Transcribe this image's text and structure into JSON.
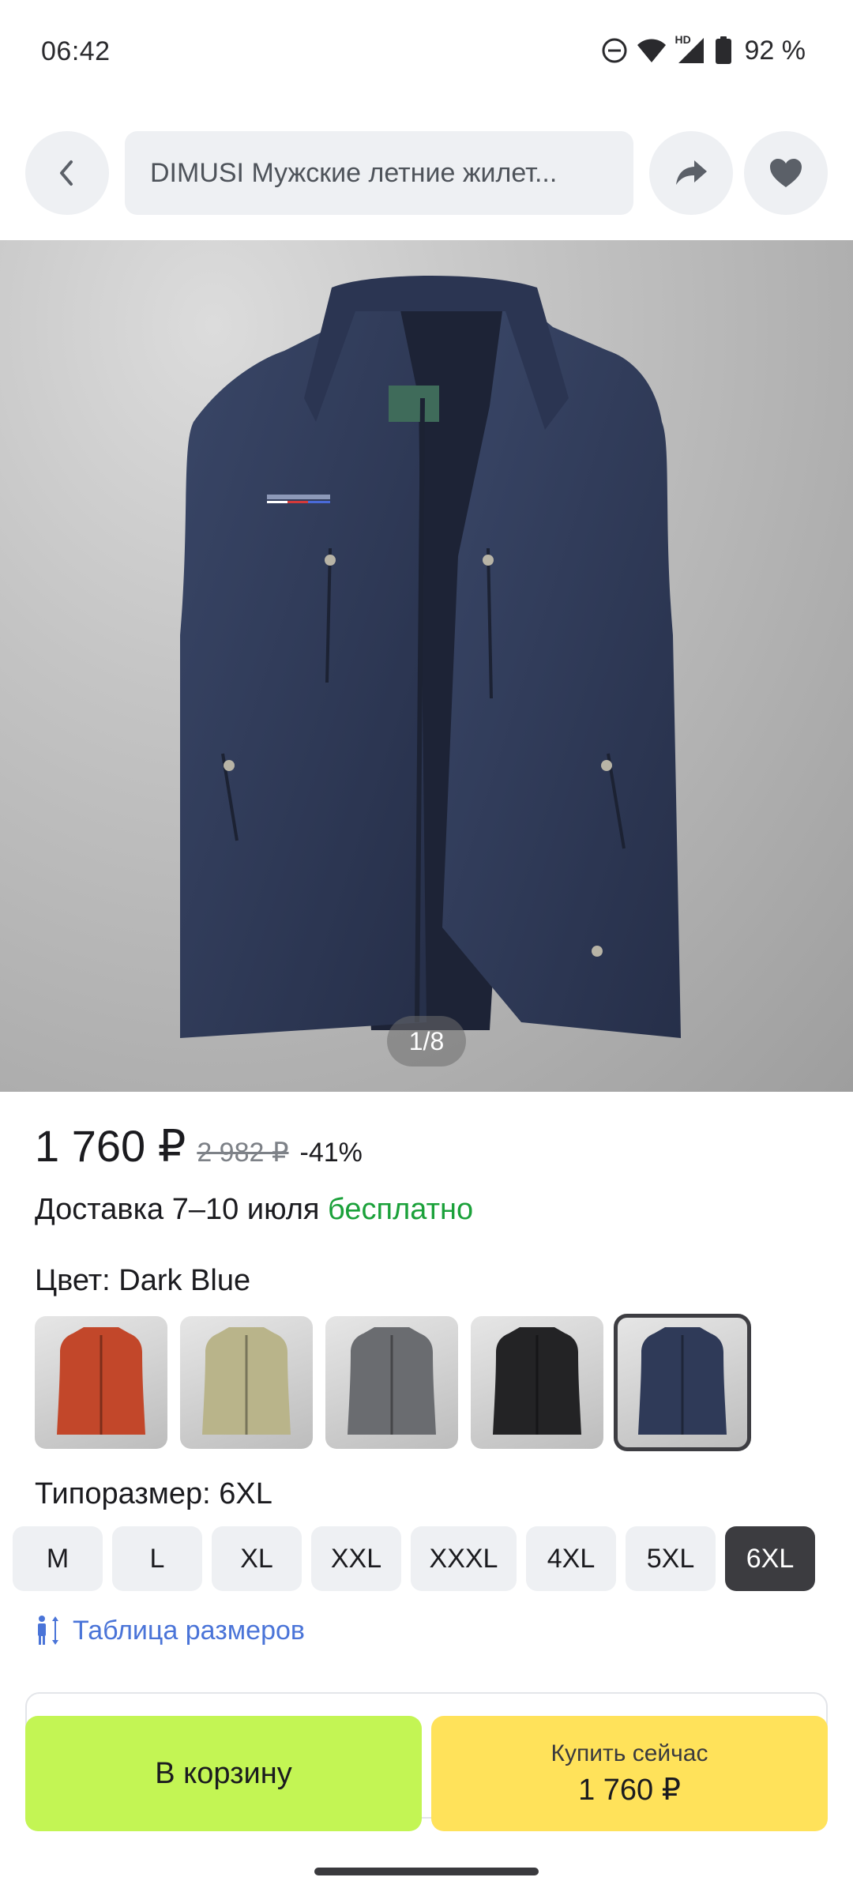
{
  "status_bar": {
    "time": "06:42",
    "icons": [
      "do-not-disturb-icon",
      "wifi-icon",
      "hd-icon",
      "cell-signal-icon",
      "battery-icon"
    ],
    "hd_label": "HD",
    "battery_percent": "92 %"
  },
  "topbar": {
    "title": "DIMUSI Мужские летние жилет...",
    "back_icon": "chevron-left-icon",
    "share_icon": "share-arrow-icon",
    "favorite_icon": "heart-icon"
  },
  "gallery": {
    "counter": "1/8",
    "current_index": 1,
    "total": 8
  },
  "pricing": {
    "price": "1 760 ₽",
    "old_price": "2 982 ₽",
    "discount": "-41%"
  },
  "delivery": {
    "text": "Доставка 7–10 июля",
    "free": "бесплатно"
  },
  "color": {
    "label": "Цвет: Dark Blue",
    "swatches": [
      {
        "name": "orange",
        "color": "#c2472a"
      },
      {
        "name": "khaki",
        "color": "#b9b48a"
      },
      {
        "name": "grey",
        "color": "#6a6c70"
      },
      {
        "name": "black",
        "color": "#232325"
      },
      {
        "name": "dark-blue",
        "color": "#2f3a58",
        "selected": true
      }
    ]
  },
  "size": {
    "label": "Типоразмер: 6XL",
    "options": [
      "M",
      "L",
      "XL",
      "XXL",
      "XXXL",
      "4XL",
      "5XL",
      "6XL"
    ],
    "selected": "6XL"
  },
  "size_table": {
    "label": "Таблица размеров",
    "icon": "size-chart-icon"
  },
  "actions": {
    "cart_label": "В корзину",
    "buy_label": "Купить сейчас",
    "buy_price": "1 760 ₽"
  },
  "colors": {
    "accent_blue": "#4a74d8",
    "free_green": "#1ba13a",
    "cart_bg": "#c3f554",
    "buy_bg": "#ffe25a",
    "vest": "#2f3a58"
  }
}
